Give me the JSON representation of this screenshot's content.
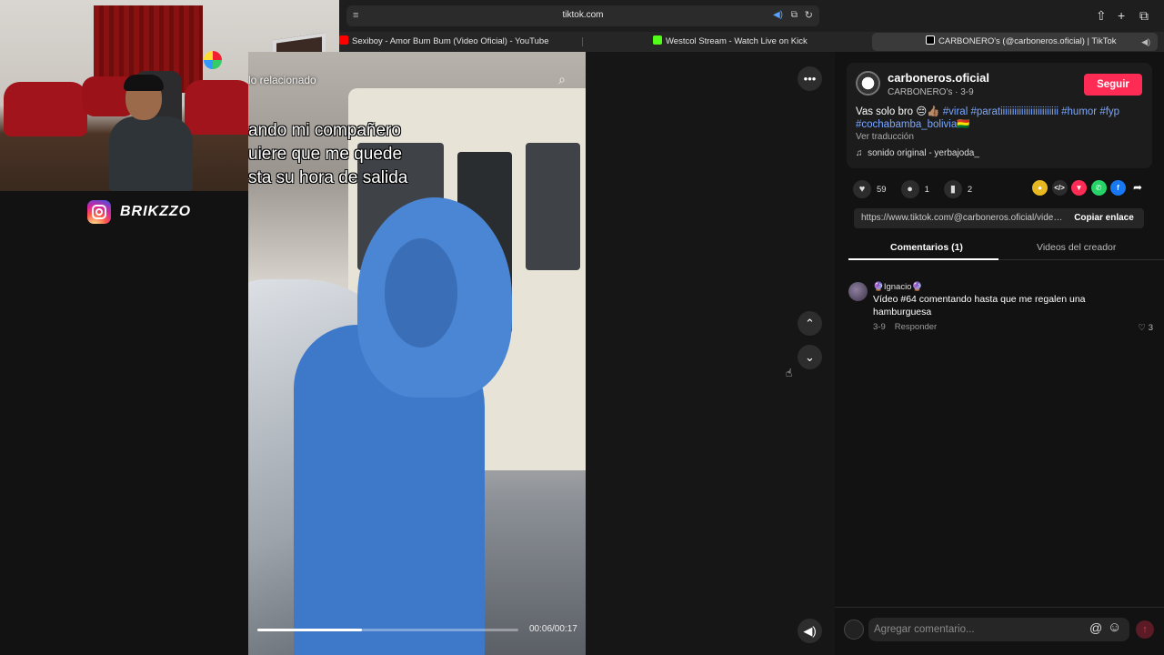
{
  "browser": {
    "url": "tiktok.com",
    "tabs": [
      {
        "label": "Sexiboy - Amor Bum Bum (Video Oficial) - YouTube",
        "favicon_color": "#ff0000"
      },
      {
        "label": "Westcol Stream - Watch Live on Kick",
        "favicon_color": "#53fc18"
      },
      {
        "label": "CARBONERO's (@carboneros.oficial) | TikTok",
        "favicon_color": "#000000"
      }
    ]
  },
  "overlay": {
    "brand_handle": "BRIKZZO"
  },
  "video": {
    "search_text": "lo relacionado",
    "caption_lines": [
      "ando mi compañero",
      "uiere que me quede",
      "sta su hora de salida"
    ],
    "progress": 0.4,
    "time": "00:06/00:17"
  },
  "post": {
    "username": "carboneros.oficial",
    "subline": "CARBONERO's · 3-9",
    "follow_label": "Seguir",
    "description_text": "Vas solo bro 😔👍🏽",
    "hashtags_line1": "#viral #paratiiiiiiiiiiiiiiiiiiiiiiiii #humor #fyp",
    "hashtags_line2": "#cochabamba_bolivia🇧🇴",
    "translate_label": "Ver traducción",
    "sound": "sonido original - yerbajoda_",
    "likes": "59",
    "comments": "1",
    "saves": "2",
    "link": "https://www.tiktok.com/@carboneros.oficial/video...",
    "copy_label": "Copiar enlace"
  },
  "tabs": {
    "comments_label": "Comentarios (1)",
    "creator_label": "Videos del creador"
  },
  "comment": {
    "user": "🔮Ignacio🔮",
    "text": "Vídeo #64 comentando hasta que me regalen una hamburguesa",
    "date": "3-9",
    "reply_label": "Responder",
    "likes": "3"
  },
  "footer": {
    "placeholder": "Agregar comentario..."
  },
  "colors": {
    "accent": "#fe2c55",
    "hashtag": "#7aa7ff"
  }
}
